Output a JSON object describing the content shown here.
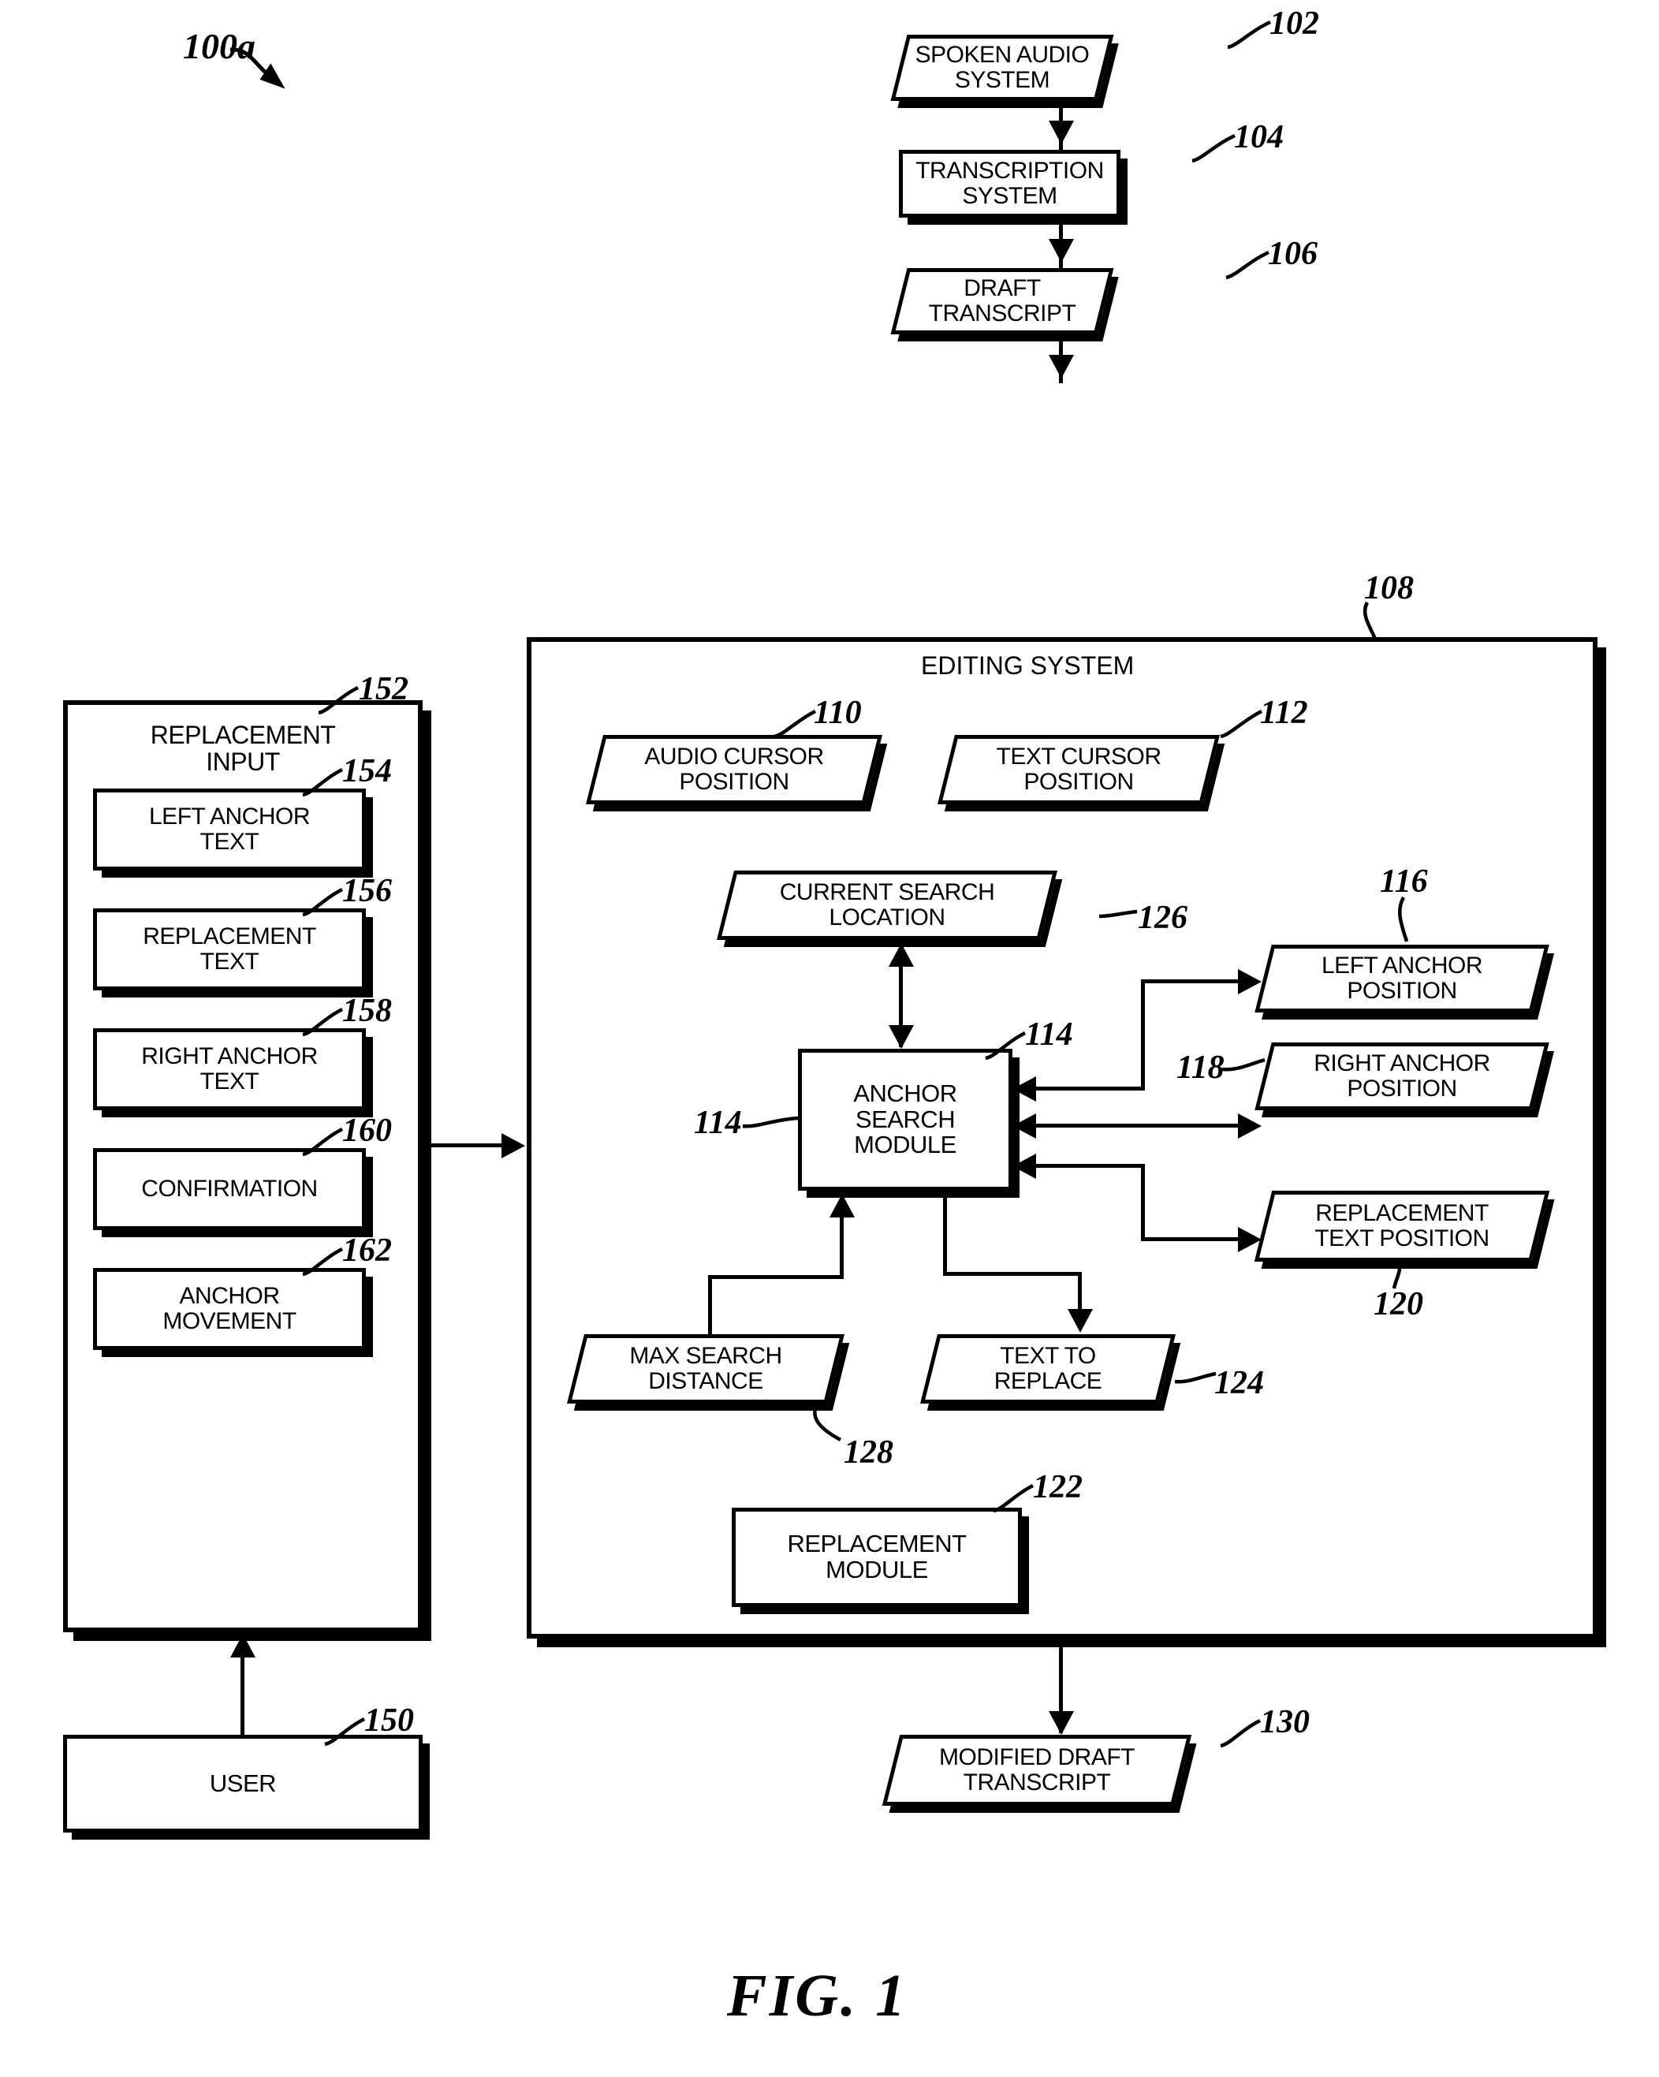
{
  "figure": {
    "caption": "FIG. 1",
    "diagram_id": "100a"
  },
  "nodes": {
    "spoken_audio_system": {
      "label": "SPOKEN AUDIO\nSYSTEM",
      "ref": "102",
      "shape": "parallelogram"
    },
    "transcription_system": {
      "label": "TRANSCRIPTION\nSYSTEM",
      "ref": "104",
      "shape": "rectangle"
    },
    "draft_transcript": {
      "label": "DRAFT\nTRANSCRIPT",
      "ref": "106",
      "shape": "parallelogram"
    },
    "editing_system": {
      "label": "EDITING SYSTEM",
      "ref": "108",
      "shape": "container"
    },
    "audio_cursor_position": {
      "label": "AUDIO CURSOR\nPOSITION",
      "ref": "110",
      "shape": "parallelogram"
    },
    "text_cursor_position": {
      "label": "TEXT CURSOR\nPOSITION",
      "ref": "112",
      "shape": "parallelogram"
    },
    "current_search_location": {
      "label": "CURRENT SEARCH\nLOCATION",
      "ref": "126",
      "shape": "parallelogram"
    },
    "anchor_search_module": {
      "label": "ANCHOR\nSEARCH\nMODULE",
      "ref": "114",
      "ref_left": "114",
      "shape": "rectangle"
    },
    "left_anchor_position": {
      "label": "LEFT ANCHOR\nPOSITION",
      "ref": "116",
      "shape": "parallelogram"
    },
    "right_anchor_position": {
      "label": "RIGHT ANCHOR\nPOSITION",
      "ref": "118",
      "shape": "parallelogram"
    },
    "replacement_text_position": {
      "label": "REPLACEMENT\nTEXT POSITION",
      "ref": "120",
      "shape": "parallelogram"
    },
    "max_search_distance": {
      "label": "MAX SEARCH\nDISTANCE",
      "ref": "128",
      "shape": "parallelogram"
    },
    "text_to_replace": {
      "label": "TEXT TO\nREPLACE",
      "ref": "124",
      "shape": "parallelogram"
    },
    "replacement_module": {
      "label": "REPLACEMENT\nMODULE",
      "ref": "122",
      "shape": "rectangle"
    },
    "modified_draft_transcript": {
      "label": "MODIFIED DRAFT\nTRANSCRIPT",
      "ref": "130",
      "shape": "parallelogram"
    },
    "replacement_input": {
      "label": "REPLACEMENT\nINPUT",
      "ref": "152",
      "shape": "container"
    },
    "left_anchor_text": {
      "label": "LEFT ANCHOR\nTEXT",
      "ref": "154",
      "shape": "rectangle"
    },
    "replacement_text": {
      "label": "REPLACEMENT\nTEXT",
      "ref": "156",
      "shape": "rectangle"
    },
    "right_anchor_text": {
      "label": "RIGHT ANCHOR\nTEXT",
      "ref": "158",
      "shape": "rectangle"
    },
    "confirmation": {
      "label": "CONFIRMATION",
      "ref": "160",
      "shape": "rectangle"
    },
    "anchor_movement": {
      "label": "ANCHOR\nMOVEMENT",
      "ref": "162",
      "shape": "rectangle"
    },
    "user": {
      "label": "USER",
      "ref": "150",
      "shape": "rectangle"
    }
  },
  "colors": {
    "stroke": "#000000",
    "fill": "#ffffff"
  }
}
